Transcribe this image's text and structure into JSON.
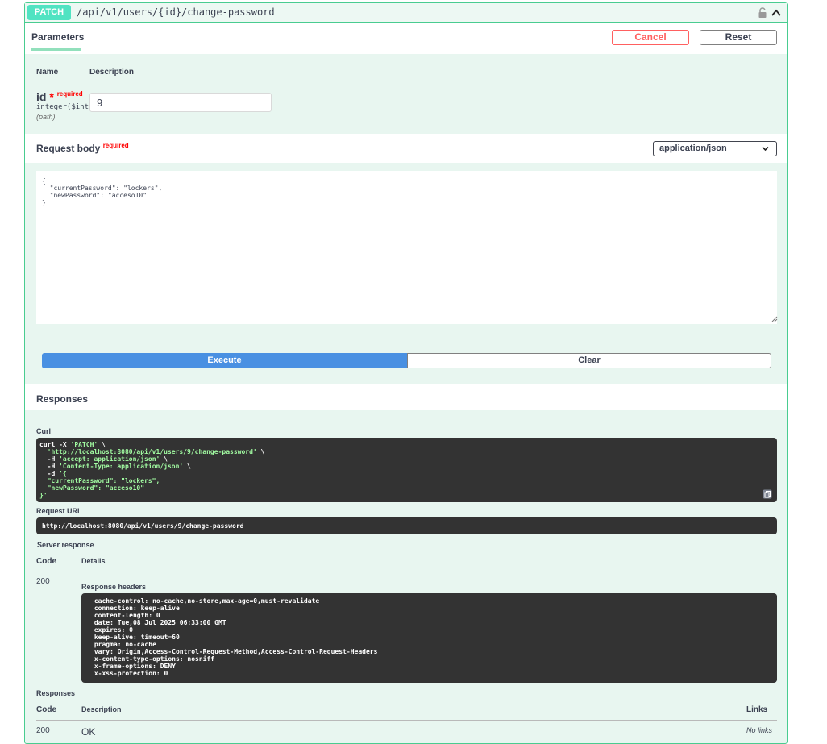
{
  "operation": {
    "method": "PATCH",
    "path": "/api/v1/users/{id}/change-password"
  },
  "parameters": {
    "tab_label": "Parameters",
    "cancel_label": "Cancel",
    "reset_label": "Reset",
    "col_name": "Name",
    "col_description": "Description",
    "param": {
      "name": "id",
      "star": "*",
      "required": "required",
      "type": "integer($int64)",
      "in": "(path)",
      "value": "9"
    }
  },
  "request_body": {
    "title": "Request body",
    "required": "required",
    "content_type": "application/json",
    "value": "{\n  \"currentPassword\": \"lockers\",\n  \"newPassword\": \"acceso10\"\n}"
  },
  "actions": {
    "execute_label": "Execute",
    "clear_label": "Clear"
  },
  "responses": {
    "title": "Responses",
    "curl_label": "Curl",
    "curl": {
      "line1": "curl -X ",
      "method": "'PATCH'",
      "line1_end": " \\",
      "url": "'http://localhost:8080/api/v1/users/9/change-password'",
      "accept_flag": "-H ",
      "accept": "'accept: application/json'",
      "ct_flag": "-H ",
      "ct": "'Content-Type: application/json'",
      "d_flag": "-d ",
      "body": "'{\n  \"currentPassword\": \"lockers\",\n  \"newPassword\": \"acceso10\"\n}'"
    },
    "request_url_label": "Request URL",
    "request_url": "http://localhost:8080/api/v1/users/9/change-password",
    "server_response_label": "Server response",
    "col_code": "Code",
    "col_details": "Details",
    "server_code": "200",
    "headers_label": "Response headers",
    "headers": " cache-control: no-cache,no-store,max-age=0,must-revalidate \n connection: keep-alive \n content-length: 0 \n date: Tue,08 Jul 2025 06:33:00 GMT \n expires: 0 \n keep-alive: timeout=60 \n pragma: no-cache \n vary: Origin,Access-Control-Request-Method,Access-Control-Request-Headers \n x-content-type-options: nosniff \n x-frame-options: DENY \n x-xss-protection: 0 ",
    "documented_label": "Responses",
    "doc_col_code": "Code",
    "doc_col_description": "Description",
    "doc_col_links": "Links",
    "doc_code": "200",
    "doc_description": "OK",
    "doc_links": "No links"
  },
  "colors": {
    "patch": "#50e3c2",
    "border": "#49cc90",
    "execute": "#4990e2",
    "cancel": "#ff6060"
  }
}
